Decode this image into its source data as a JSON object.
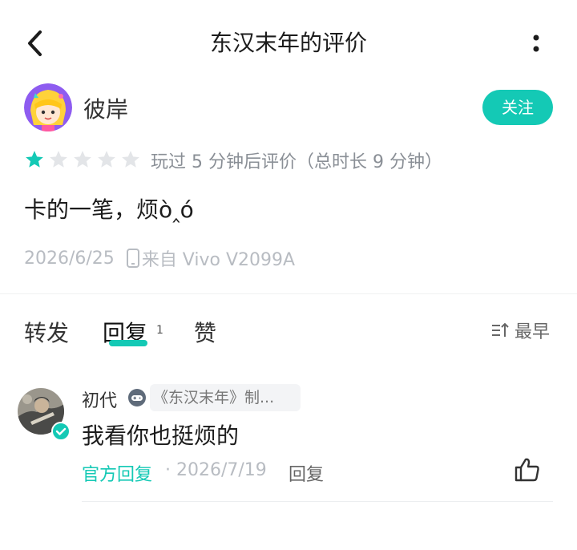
{
  "header": {
    "title": "东汉末年的评价",
    "back_icon": "chevron-left-icon",
    "more_icon": "more-vertical-icon"
  },
  "review": {
    "author": "彼岸",
    "follow_label": "关注",
    "rating": 1,
    "rating_max": 5,
    "play_note": "玩过 5 分钟后评价（总时长 9 分钟）",
    "text": "卡的一笔，烦ò‸ó",
    "date": "2026/6/25",
    "device": "来自 Vivo V2099A"
  },
  "tabs": {
    "forward": "转发",
    "reply": "回复",
    "reply_count": "1",
    "like": "赞",
    "sort": "最早"
  },
  "reply": {
    "author": "初代",
    "game_tag": "《东汉末年》制...",
    "text": "我看你也挺烦的",
    "official_label": "官方回复",
    "date": "· 2026/7/19",
    "reply_label": "回复"
  },
  "colors": {
    "accent": "#14c9b5",
    "muted": "#b8bcc2"
  }
}
